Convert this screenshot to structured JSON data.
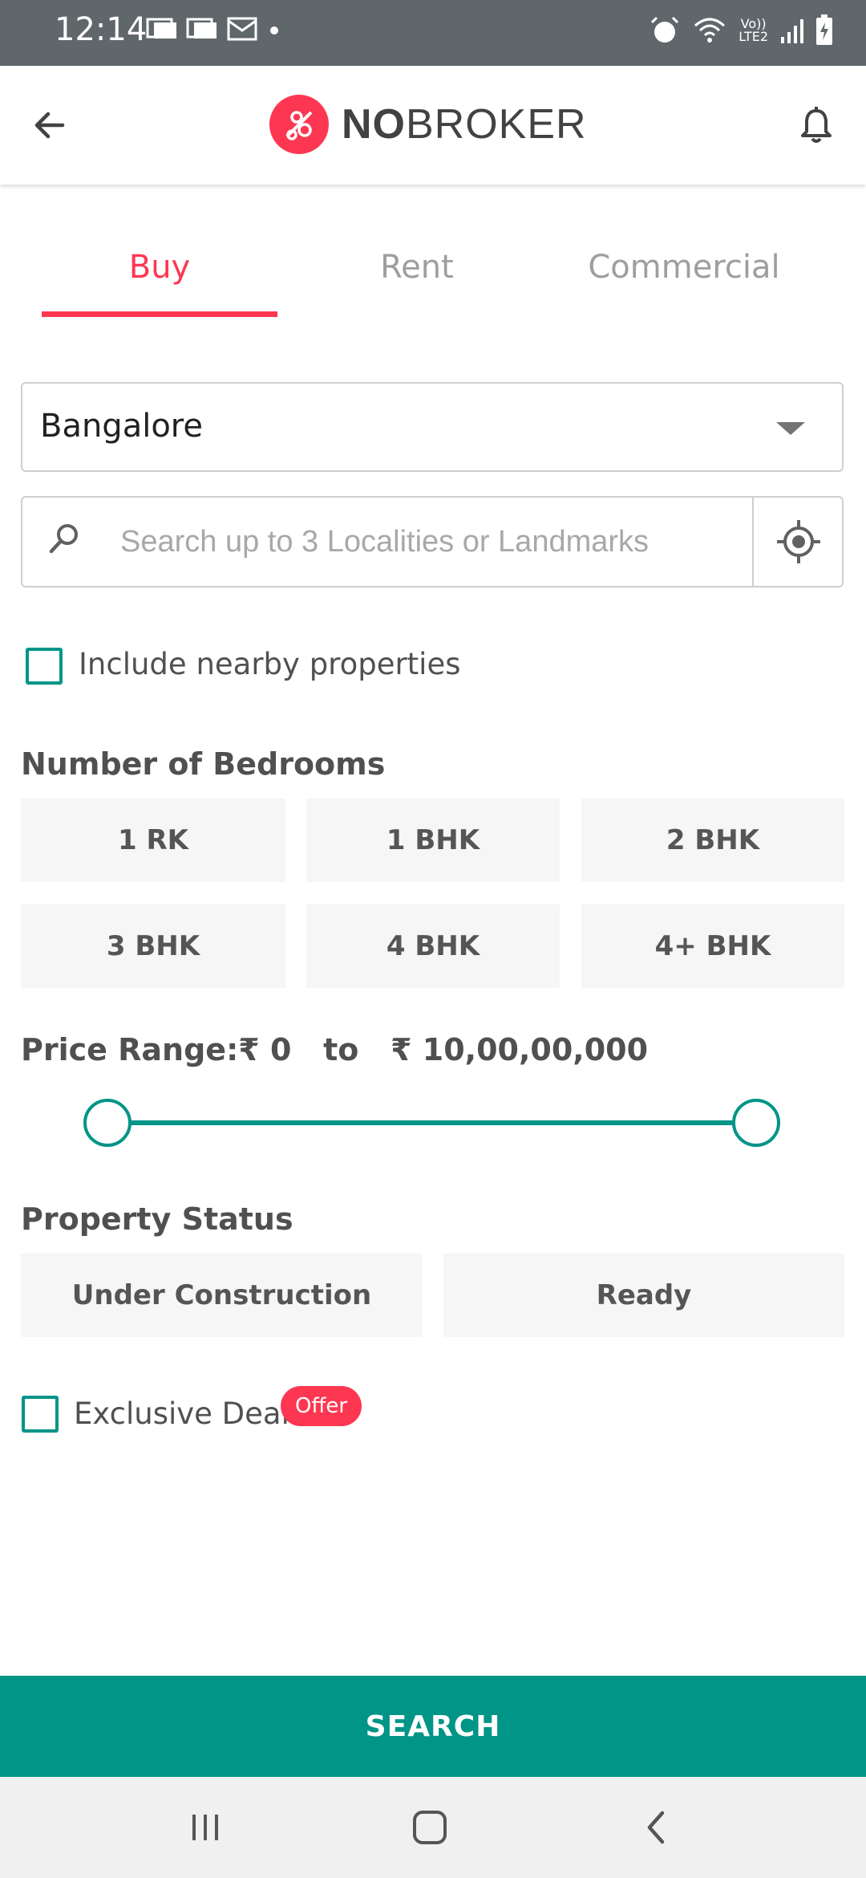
{
  "status_bar": {
    "time": "12:14",
    "network_label_top": "Vo))",
    "network_label_bottom": "LTE2"
  },
  "app_bar": {
    "logo_text_bold": "NO",
    "logo_text_regular": "BROKER",
    "back_icon": "arrow-left-icon",
    "bell_icon": "bell-icon"
  },
  "tabs": [
    {
      "label": "Buy",
      "active": true
    },
    {
      "label": "Rent",
      "active": false
    },
    {
      "label": "Commercial",
      "active": false
    }
  ],
  "city_select": {
    "value": "Bangalore"
  },
  "search": {
    "placeholder": "Search up to 3 Localities or Landmarks",
    "value": ""
  },
  "nearby": {
    "label": "Include nearby properties",
    "checked": false
  },
  "bedrooms": {
    "title": "Number of Bedrooms",
    "options": [
      "1 RK",
      "1 BHK",
      "2 BHK",
      "3 BHK",
      "4 BHK",
      "4+ BHK"
    ]
  },
  "price_range": {
    "prefix": "Price Range:",
    "min_label": "₹ 0",
    "to": "to",
    "max_label": "₹ 10,00,00,000",
    "min_value": 0,
    "max_value": 100000000
  },
  "property_status": {
    "title": "Property Status",
    "options": [
      "Under Construction",
      "Ready"
    ]
  },
  "exclusive_deals": {
    "label": "Exclusive Deals",
    "badge": "Offer",
    "checked": false
  },
  "search_button": {
    "label": "SEARCH"
  },
  "colors": {
    "accent": "#fd3752",
    "teal": "#009587",
    "status_bar": "#5f676b"
  }
}
